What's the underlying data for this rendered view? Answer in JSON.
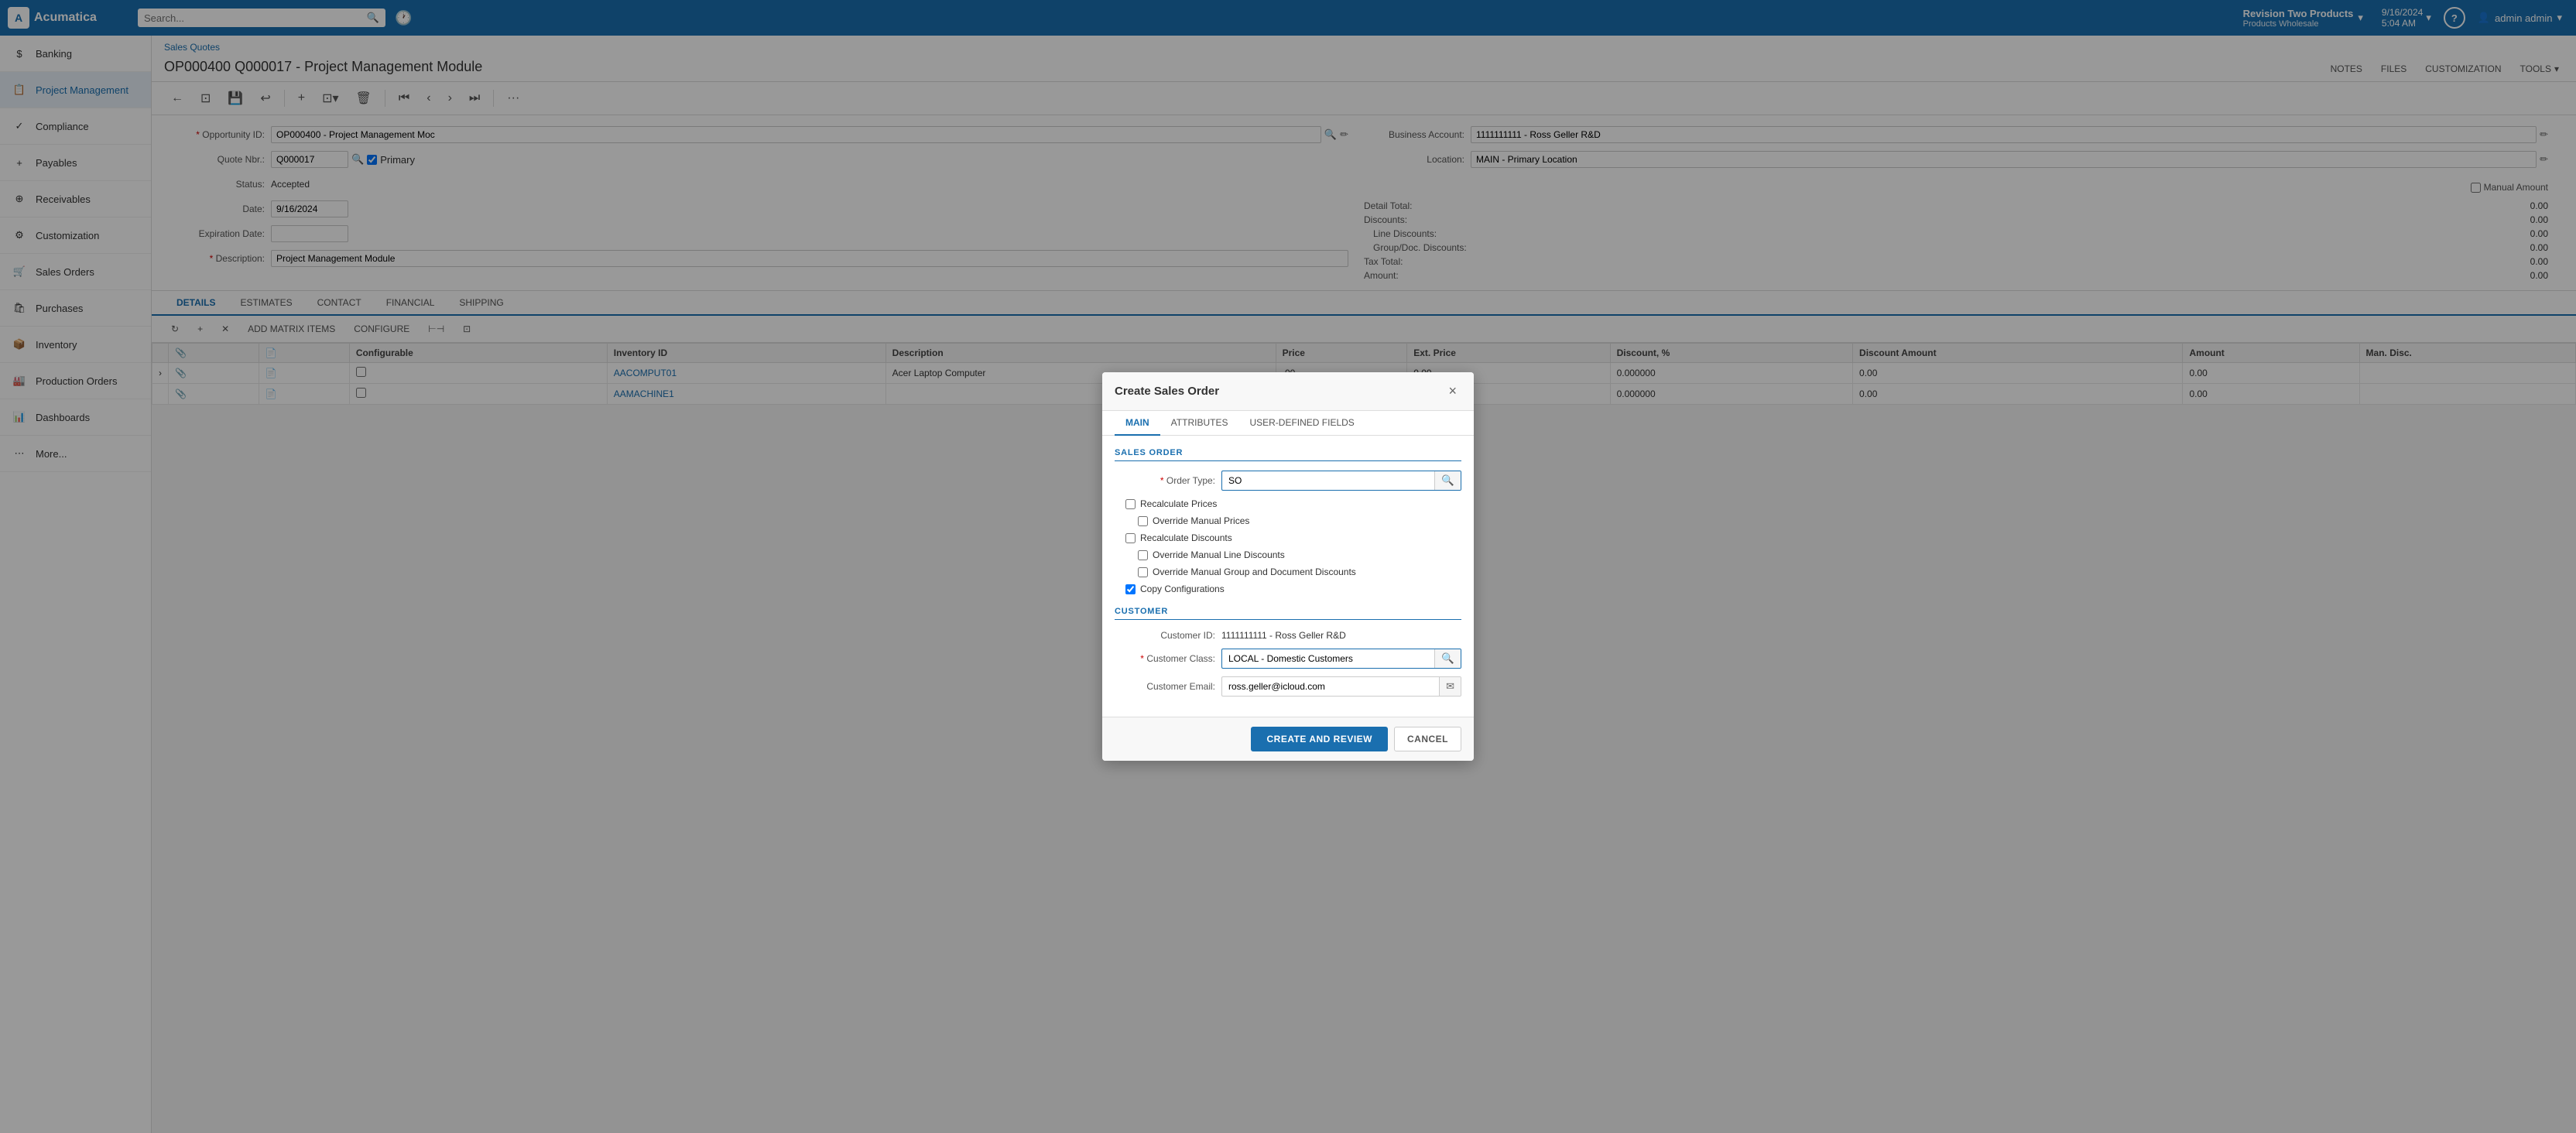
{
  "app": {
    "name": "Acumatica",
    "logo_text": "A"
  },
  "top_nav": {
    "search_placeholder": "Search...",
    "tenant": {
      "name": "Revision Two Products",
      "sub": "Products Wholesale"
    },
    "datetime": {
      "date": "9/16/2024",
      "time": "5:04 AM"
    },
    "user": "admin admin",
    "help_label": "?"
  },
  "sidebar": {
    "items": [
      {
        "label": "Banking",
        "icon": "$"
      },
      {
        "label": "Project Management",
        "icon": "📋"
      },
      {
        "label": "Compliance",
        "icon": "✓"
      },
      {
        "label": "Payables",
        "icon": "+"
      },
      {
        "label": "Receivables",
        "icon": "⊕"
      },
      {
        "label": "Customization",
        "icon": "⚙"
      },
      {
        "label": "Sales Orders",
        "icon": "🛒"
      },
      {
        "label": "Purchases",
        "icon": "🛍"
      },
      {
        "label": "Inventory",
        "icon": "📦"
      },
      {
        "label": "Production Orders",
        "icon": "🏭"
      },
      {
        "label": "Dashboards",
        "icon": "📊"
      },
      {
        "label": "More...",
        "icon": "⋯"
      }
    ]
  },
  "breadcrumb": "Sales Quotes",
  "page_title": "OP000400 Q000017 - Project Management Module",
  "page_actions": {
    "notes": "NOTES",
    "files": "FILES",
    "customization": "CUSTOMIZATION",
    "tools": "TOOLS"
  },
  "toolbar": {
    "back": "←",
    "copy": "⊡",
    "save": "💾",
    "undo": "↩",
    "add": "+",
    "add_split": "⊡▾",
    "delete": "🗑",
    "first": "⏮",
    "prev": "‹",
    "next": "›",
    "last": "⏭",
    "more": "···"
  },
  "form": {
    "opportunity_id_label": "Opportunity ID:",
    "opportunity_id_value": "OP000400 - Project Management Moc",
    "quote_nbr_label": "Quote Nbr.:",
    "quote_nbr_value": "Q000017",
    "primary_checkbox": "Primary",
    "status_label": "Status:",
    "status_value": "Accepted",
    "date_label": "Date:",
    "date_value": "9/16/2024",
    "expiration_label": "Expiration Date:",
    "expiration_value": "",
    "description_label": "Description:",
    "description_value": "Project Management Module",
    "business_account_label": "Business Account:",
    "business_account_value": "1111111111 - Ross Geller R&D",
    "location_label": "Location:",
    "location_value": "MAIN - Primary Location",
    "manual_amount_label": "Manual Amount",
    "detail_total_label": "Detail Total:",
    "detail_total_value": "0.00",
    "discount_total_label": "Discount Total:",
    "discount_total_value": "0.00",
    "line_discounts_label": "Line Discounts:",
    "line_discounts_value": "0.00",
    "group_doc_discounts_label": "Group/Doc. Discounts:",
    "group_doc_discounts_value": "0.00",
    "tax_total_label": "Tax Total:",
    "tax_total_value": "0.00",
    "amount_label": "Amount:",
    "amount_value": "0.00"
  },
  "tabs": {
    "items": [
      "DETAILS",
      "ESTIMATES",
      "CONTACT",
      "FINANCIAL",
      "SHIPPING"
    ]
  },
  "sub_toolbar": {
    "refresh": "↻",
    "add_row": "+",
    "delete_row": "✕",
    "add_matrix": "ADD MATRIX ITEMS",
    "configure": "CONFIGURE",
    "fit_columns": "⊢⊣",
    "extra": "⊡"
  },
  "table": {
    "columns": [
      "",
      "",
      "Configurable",
      "Inventory ID",
      "Description",
      "Price",
      "Ext. Price",
      "Discount, %",
      "Discount Amount",
      "Amount",
      "Man. Disc."
    ],
    "rows": [
      {
        "chevron": "›",
        "col1": "",
        "col2": "",
        "configurable": "",
        "inventory_id": "AACOMPUT01",
        "description": "Acer Laptop Computer",
        "price": ".00",
        "ext_price": "0.00",
        "discount_pct": "0.000000",
        "discount_amt": "0.00",
        "amount": "0.00",
        "man_disc": ""
      },
      {
        "chevron": "",
        "col1": "",
        "col2": "",
        "configurable": "",
        "inventory_id": "AAMACHINE1",
        "description": "",
        "price": ".00",
        "ext_price": "0.00",
        "discount_pct": "0.000000",
        "discount_amt": "0.00",
        "amount": "0.00",
        "man_disc": ""
      }
    ]
  },
  "modal": {
    "title": "Create Sales Order",
    "close_btn": "×",
    "tabs": [
      "MAIN",
      "ATTRIBUTES",
      "USER-DEFINED FIELDS"
    ],
    "active_tab": "MAIN",
    "sales_order_section": "SALES ORDER",
    "order_type_label": "Order Type:",
    "order_type_value": "SO",
    "recalculate_prices": "Recalculate Prices",
    "override_manual_prices": "Override Manual Prices",
    "recalculate_discounts": "Recalculate Discounts",
    "override_manual_line_discounts": "Override Manual Line Discounts",
    "override_group_doc_discounts": "Override Manual Group and Document Discounts",
    "copy_configurations": "Copy Configurations",
    "copy_configurations_checked": true,
    "customer_section": "CUSTOMER",
    "customer_id_label": "Customer ID:",
    "customer_id_value": "1111111111 - Ross Geller R&D",
    "customer_class_label": "Customer Class:",
    "customer_class_value": "LOCAL - Domestic Customers",
    "customer_email_label": "Customer Email:",
    "customer_email_value": "ross.geller@icloud.com",
    "create_btn": "CREATE AND REVIEW",
    "cancel_btn": "CANCEL"
  }
}
